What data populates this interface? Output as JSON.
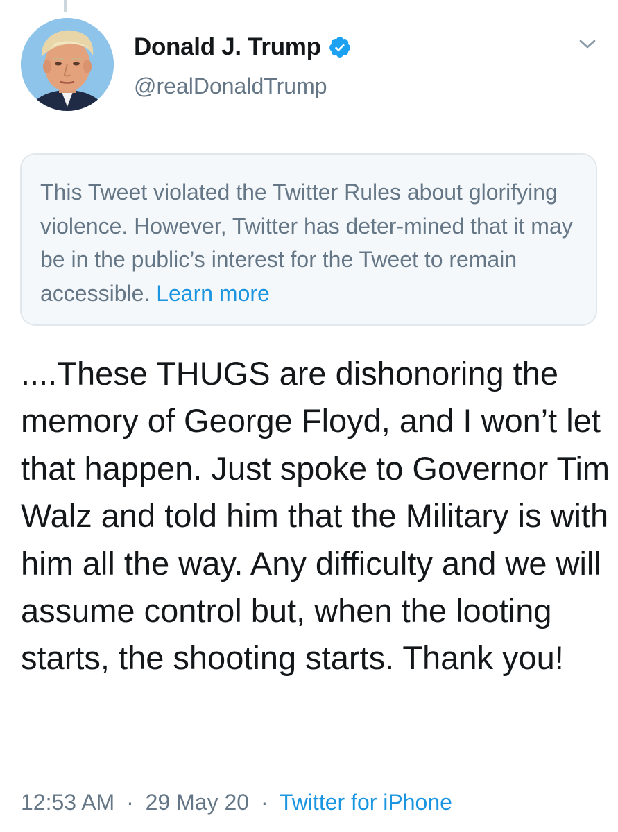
{
  "author": {
    "display_name": "Donald J. Trump",
    "handle": "@realDonaldTrump",
    "verified": true,
    "avatar_icon": "profile-photo",
    "verified_icon": "verified-badge-icon",
    "menu_icon": "chevron-down-icon"
  },
  "notice": {
    "text": "This Tweet violated the Twitter Rules about glorifying violence. However, Twitter has deter-mined that it may be in the public’s interest for the Tweet to remain accessible.",
    "link_label": "Learn more"
  },
  "tweet": {
    "text": "....These THUGS are dishonoring the memory of George Floyd, and I won’t let that happen. Just spoke to Governor Tim Walz and told him that the Military is with him all the way. Any difficulty and we will assume control but, when the looting starts, the shooting starts. Thank you!"
  },
  "meta": {
    "time": "12:53 AM",
    "date": "29 May 20",
    "separator": "·",
    "source": "Twitter for iPhone"
  },
  "colors": {
    "link": "#1b95e0",
    "secondary_text": "#657786",
    "primary_text": "#14171a",
    "notice_bg": "#f5f8fa",
    "notice_border": "#e1e8ed"
  }
}
